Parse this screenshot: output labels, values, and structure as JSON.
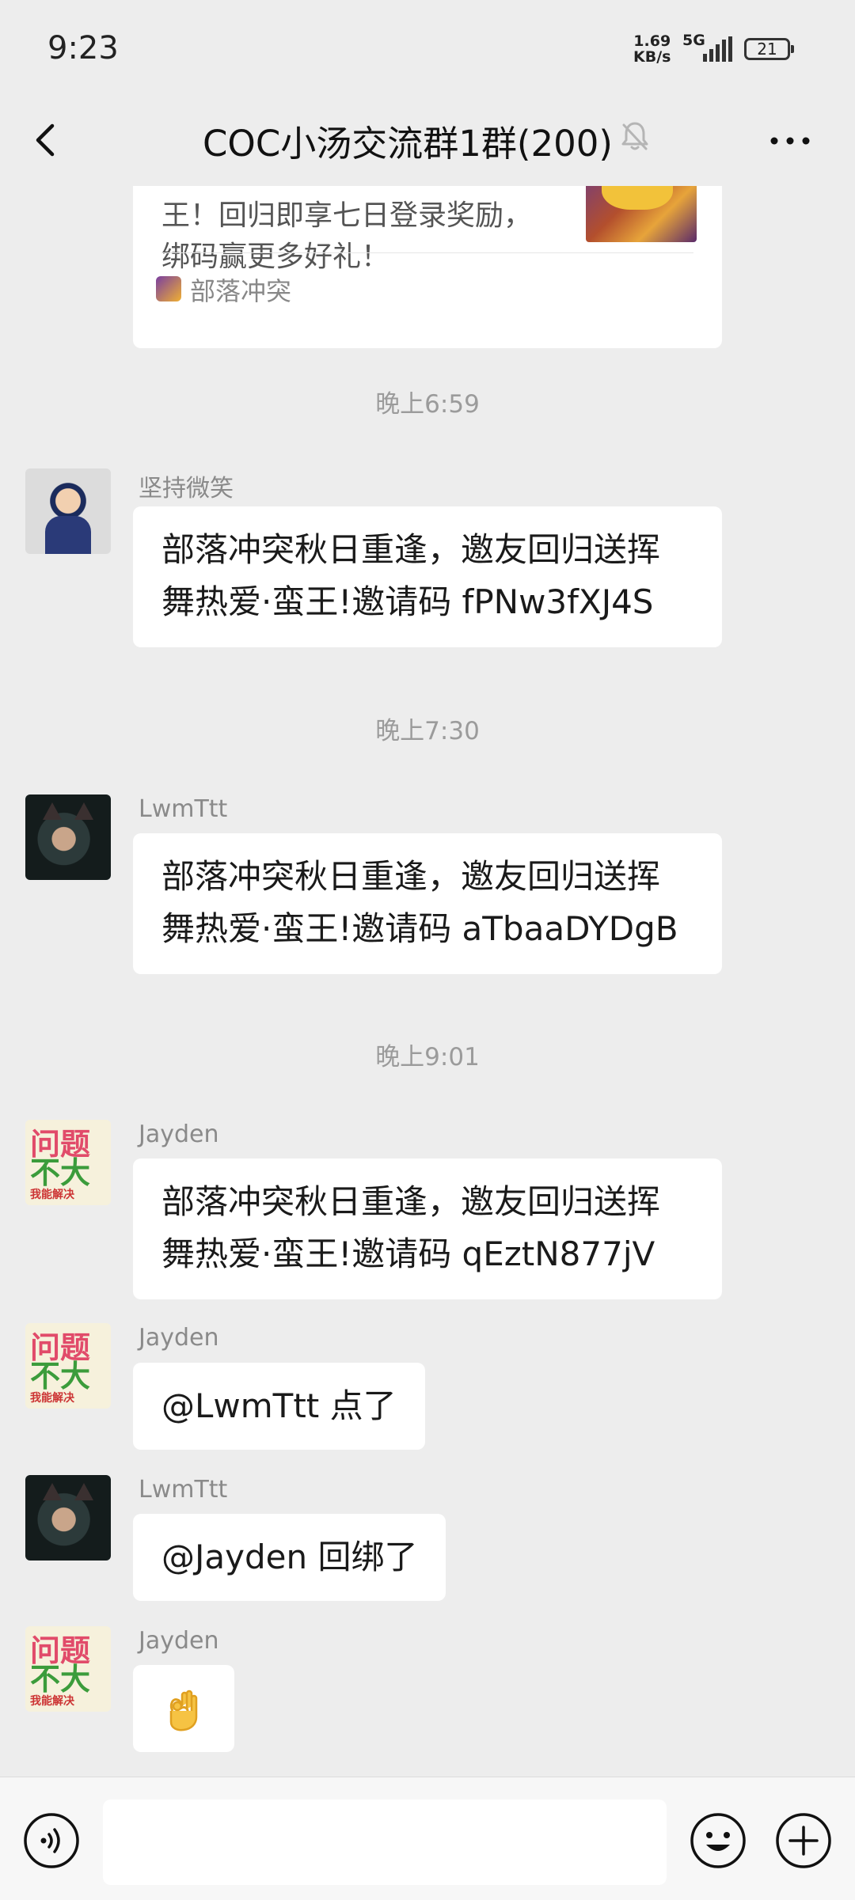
{
  "status_bar": {
    "time": "9:23",
    "net_speed_value": "1.69",
    "net_speed_unit": "KB/s",
    "network": "5G",
    "battery": "21"
  },
  "header": {
    "title": "COC小汤交流群1群(200)",
    "icons": [
      "back-arrow-icon",
      "mute-bell-icon",
      "more-dots-icon"
    ]
  },
  "card": {
    "text": "王！回归即享七日登录奖励，\n绑码赢更多好礼！",
    "source": "部落冲突"
  },
  "messages": [
    {
      "timestamp": "晚上6:59"
    },
    {
      "sender": "坚持微笑",
      "text": "部落冲突秋日重逢，邀友回归送挥\n舞热爱·蛮王!邀请码 fPNw3fXJ4S"
    },
    {
      "timestamp": "晚上7:30"
    },
    {
      "sender": "LwmTtt",
      "text": "部落冲突秋日重逢，邀友回归送挥\n舞热爱·蛮王!邀请码 aTbaaDYDgB"
    },
    {
      "timestamp": "晚上9:01"
    },
    {
      "sender": "Jayden",
      "text": "部落冲突秋日重逢，邀友回归送挥\n舞热爱·蛮王!邀请码 qEztN877jV"
    },
    {
      "sender": "Jayden",
      "text": "@LwmTtt  点了"
    },
    {
      "sender": "LwmTtt",
      "text": "@Jayden  回绑了"
    },
    {
      "sender": "Jayden",
      "emoji": "ok-hand-emoji"
    }
  ],
  "sticker_avatar": {
    "line1": "问题",
    "line2": "不大",
    "line3": "我能解决"
  },
  "input_bar": {
    "placeholder": "",
    "icons": [
      "voice-icon",
      "emoji-icon",
      "plus-icon"
    ]
  },
  "colors": {
    "background": "#ededed",
    "bubble": "#ffffff",
    "meta_text": "#9b9b9b"
  }
}
